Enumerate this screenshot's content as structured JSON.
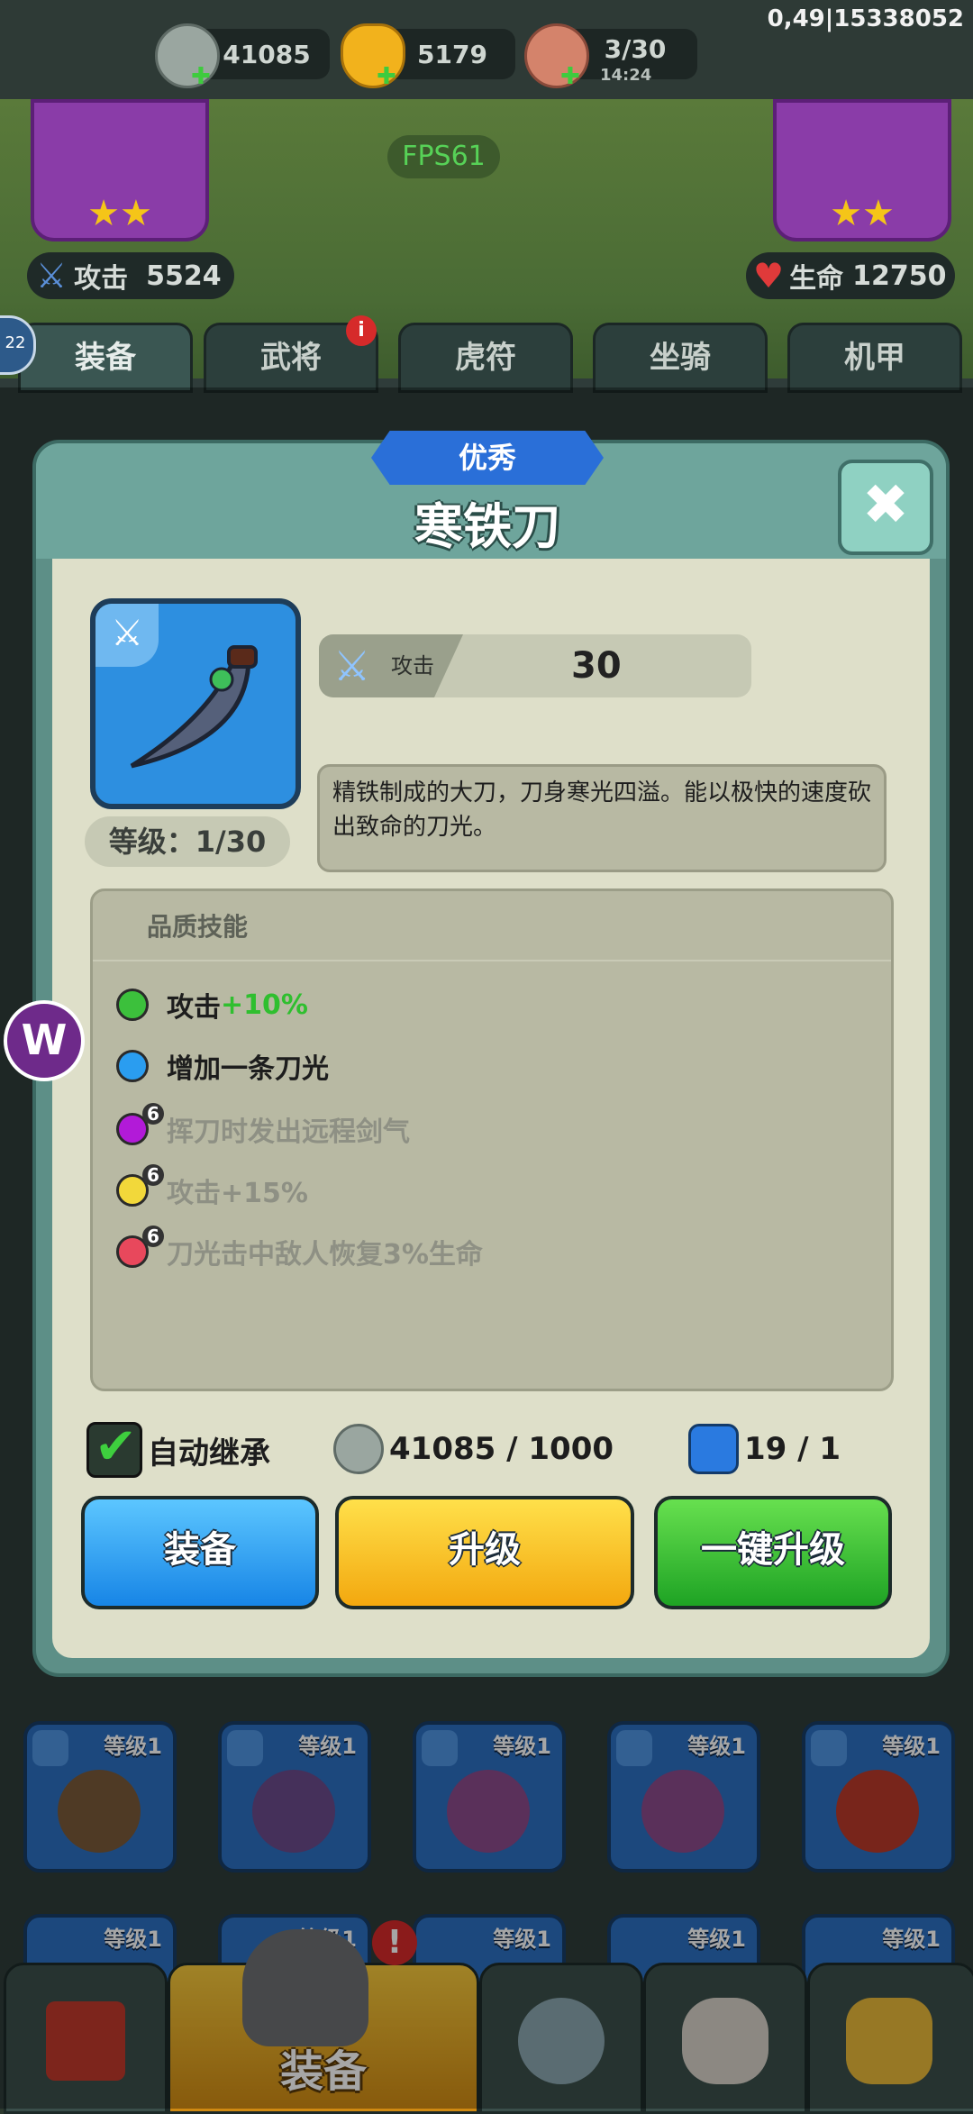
{
  "status": {
    "top_right": "0,49|15338052"
  },
  "resources": [
    {
      "name": "silver-coin-icon",
      "value": "41085"
    },
    {
      "name": "gold-ingot-icon",
      "value": "5179"
    },
    {
      "name": "meat-icon",
      "value": "3/30",
      "timer": "14:24"
    }
  ],
  "fps": "FPS61",
  "stats": {
    "attack_label": "攻击",
    "attack_value": "5524",
    "life_label": "生命",
    "life_value": "12750"
  },
  "tabs": [
    "装备",
    "武将",
    "虎符",
    "坐骑",
    "机甲"
  ],
  "tab_badge": "i",
  "dialog": {
    "quality": "优秀",
    "item_name": "寒铁刀",
    "attack_label": "攻击",
    "attack_value": "30",
    "level": "等级：1/30",
    "description": "精铁制成的大刀，刀身寒光四溢。能以极快的速度砍出致命的刀光。",
    "skills_title": "品质技能",
    "skills": [
      {
        "text": "攻击",
        "bonus": "+10%",
        "color": "#3cc03c",
        "locked": false
      },
      {
        "text": "增加一条刀光",
        "bonus": "",
        "color": "#2a9df0",
        "locked": false
      },
      {
        "text": "挥刀时发出远程剑气",
        "bonus": "",
        "color": "#b21ad8",
        "locked": true
      },
      {
        "text": "攻击+15%",
        "bonus": "",
        "color": "#f2d83a",
        "locked": true
      },
      {
        "text": "刀光击中敌人恢复3%生命",
        "bonus": "",
        "color": "#e8485c",
        "locked": true
      }
    ],
    "lock_mark": "6",
    "auto_inherit": "自动继承",
    "cost_coin": "41085 / 1000",
    "cost_stone": "19 / 1",
    "btn_equip": "装备",
    "btn_upgrade": "升级",
    "btn_oneclick": "一键升级"
  },
  "inventory_row1": [
    "等级1",
    "等级1",
    "等级1",
    "等级1",
    "等级1"
  ],
  "inventory_row2": [
    "等级1",
    "等级1",
    "等级1",
    "等级1",
    "等级1"
  ],
  "bottom_nav": {
    "active_label": "装备",
    "badge": "!"
  },
  "floating": {
    "w_label": "W",
    "mini_label": "22"
  }
}
